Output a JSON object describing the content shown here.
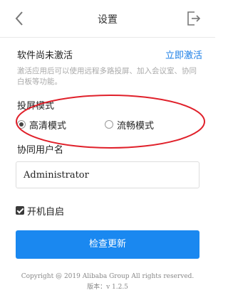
{
  "header": {
    "title": "设置",
    "back_icon": "chevron-left-icon",
    "exit_icon": "exit-icon"
  },
  "activation": {
    "status_text": "软件尚未激活",
    "activate_link": "立即激活",
    "hint": "激活应用后可以使用远程多路投屏、加入会议室、协同白板等功能。"
  },
  "projection": {
    "label": "投屏模式",
    "options": [
      {
        "label": "高清模式",
        "selected": true
      },
      {
        "label": "流畅模式",
        "selected": false
      }
    ],
    "highlight_color": "#e0202a"
  },
  "collab_user": {
    "label": "协同用户名",
    "value": "Administrator"
  },
  "autostart": {
    "label": "开机自启",
    "checked": true
  },
  "update_button": {
    "label": "检查更新",
    "color": "#1a88f0"
  },
  "footer": {
    "copyright": "Copyright @ 2019 Alibaba Group All rights reserved.",
    "version": "版本：v 1.2.5"
  }
}
